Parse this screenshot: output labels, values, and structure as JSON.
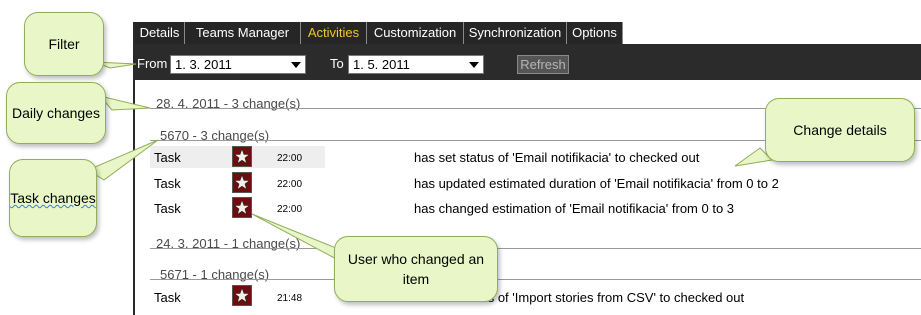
{
  "tabs": [
    {
      "label": "Details"
    },
    {
      "label": "Teams Manager"
    },
    {
      "label": "Activities",
      "active": true
    },
    {
      "label": "Customization"
    },
    {
      "label": "Synchronization"
    },
    {
      "label": "Options"
    }
  ],
  "filter": {
    "from_label": "From",
    "from_value": "1. 3. 2011",
    "to_label": "To",
    "to_value": "1. 5. 2011",
    "refresh_label": "Refresh"
  },
  "days": [
    {
      "header": "28. 4. 2011  -  3 change(s)",
      "tasks": [
        {
          "header": "5670  -  3 change(s)",
          "changes": [
            {
              "type": "Task",
              "time": "22:00",
              "description": "has set status of 'Email notifikacia' to checked out"
            },
            {
              "type": "Task",
              "time": "22:00",
              "description": "has updated estimated duration of 'Email notifikacia' from 0 to 2"
            },
            {
              "type": "Task",
              "time": "22:00",
              "description": "has changed estimation of 'Email notifikacia' from 0 to 3"
            }
          ]
        }
      ]
    },
    {
      "header": "24. 3. 2011  -  1 change(s)",
      "tasks": [
        {
          "header": "5671  -  1 change(s)",
          "changes": [
            {
              "type": "Task",
              "time": "21:48",
              "description": "has set status of 'Import stories from CSV' to checked out"
            }
          ]
        }
      ]
    }
  ],
  "callouts": {
    "filter": "Filter",
    "daily_changes": "Daily changes",
    "task_changes": "Task changes",
    "user": "User who changed an item",
    "change_details": "Change details"
  },
  "colors": {
    "active_tab": "#f2c431",
    "toolbar_bg": "#2b2b2b",
    "callout_bg": "#e9f7c8",
    "callout_border": "#8fae5a"
  },
  "icons": {
    "avatar": "star-avatar-icon",
    "dropdown": "chevron-down-icon"
  }
}
